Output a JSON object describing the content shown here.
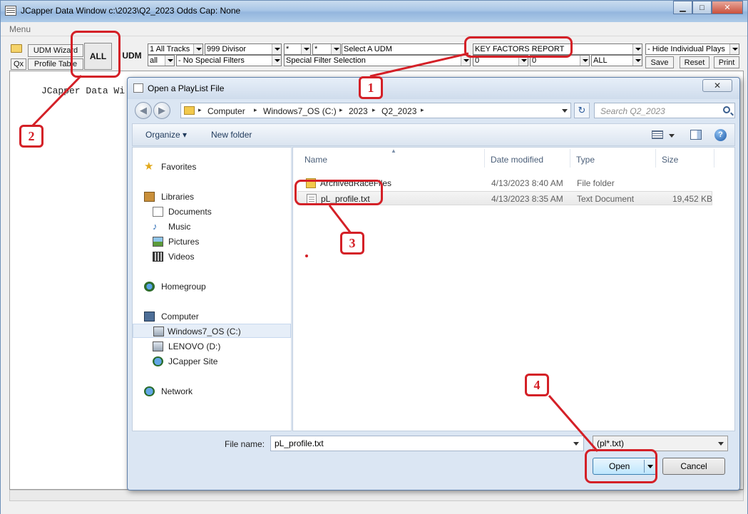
{
  "main_window": {
    "title": "JCapper Data Window c:\\2023\\Q2_2023 Odds Cap: None",
    "controls": {
      "minimize": "▁",
      "maximize": "□",
      "close": "✕"
    },
    "menu": "Menu",
    "content_text": "JCapper Data Wi"
  },
  "toolbar": {
    "udm_wizard": "UDM Wizard",
    "qx": "Qx",
    "profile_table": "Profile Table",
    "all": "ALL",
    "udm": "UDM",
    "tracks": "1 All Tracks",
    "divisor": "999 Divisor",
    "star1": "*",
    "star2": "*",
    "select_udm": "Select A UDM",
    "report": "KEY FACTORS REPORT",
    "hide_plays": "- Hide Individual Plays",
    "all_small": "all",
    "special_filters": "- No Special Filters",
    "special_filter_selection": "Special Filter Selection",
    "zero1": "0",
    "zero2": "0",
    "all_caps": "ALL",
    "save": "Save",
    "reset": "Reset",
    "print": "Print"
  },
  "dialog": {
    "title": "Open a PlayList File",
    "close": "✕",
    "nav_back": "◀",
    "nav_forward": "▶",
    "breadcrumbs": [
      "Computer",
      "Windows7_OS (C:)",
      "2023",
      "Q2_2023"
    ],
    "breadcrumb_sep": "▸",
    "refresh": "↻",
    "search_placeholder": "Search Q2_2023",
    "organize": "Organize ▾",
    "new_folder": "New folder",
    "help": "?",
    "nav": {
      "favorites": "Favorites",
      "libraries": "Libraries",
      "documents": "Documents",
      "music": "Music",
      "pictures": "Pictures",
      "videos": "Videos",
      "homegroup": "Homegroup",
      "computer": "Computer",
      "drive_c": "Windows7_OS (C:)",
      "drive_d": "LENOVO (D:)",
      "jcapper_site": "JCapper Site",
      "network": "Network"
    },
    "columns": {
      "name": "Name",
      "date": "Date modified",
      "type": "Type",
      "size": "Size"
    },
    "files": [
      {
        "name": "ArchivedRaceFiles",
        "date": "4/13/2023 8:40 AM",
        "type": "File folder",
        "size": ""
      },
      {
        "name": "pL_profile.txt",
        "date": "4/13/2023 8:35 AM",
        "type": "Text Document",
        "size": "19,452 KB"
      }
    ],
    "file_name_label": "File name:",
    "file_name_value": "pL_profile.txt",
    "filter": "(pl*.txt)",
    "open": "Open",
    "cancel": "Cancel"
  },
  "annotations": {
    "n1": "1",
    "n2": "2",
    "n3": "3",
    "n4": "4"
  },
  "colors": {
    "annotation_red": "#d42027",
    "titlebar": "#a9c6e6",
    "dialog_bg": "#dbe6f3"
  }
}
